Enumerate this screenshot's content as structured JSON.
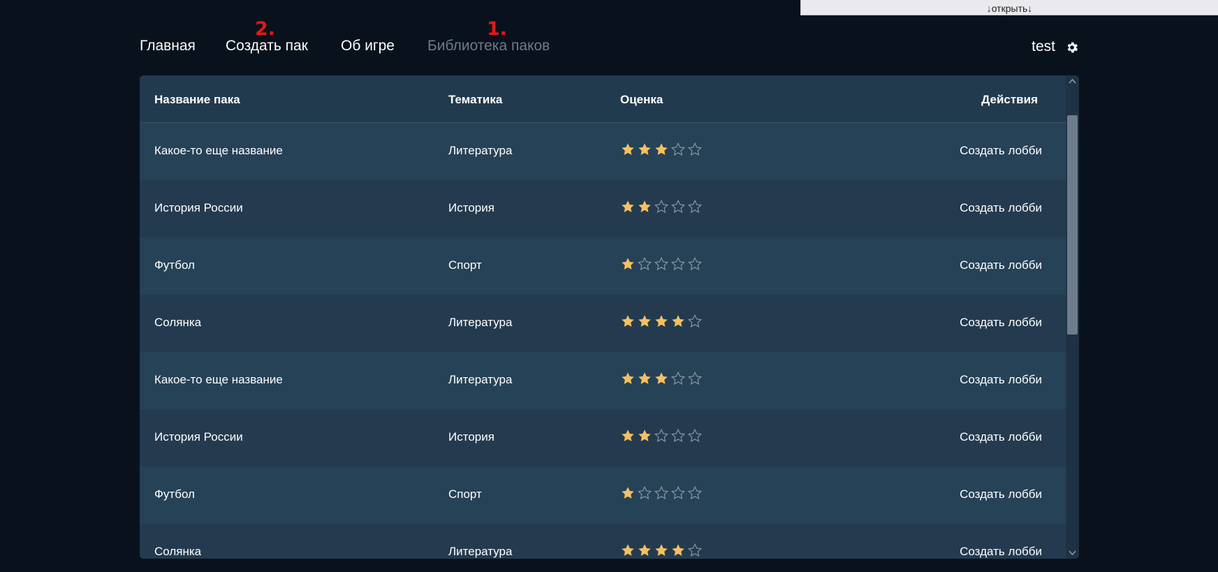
{
  "top_tab": {
    "label": "↓открыть↓"
  },
  "nav": {
    "items": [
      {
        "label": "Главная",
        "active": false
      },
      {
        "label": "Создать пак",
        "active": false,
        "marker": "2."
      },
      {
        "label": "Об игре",
        "active": false
      },
      {
        "label": "Библиотека паков",
        "active": true,
        "marker": "1."
      }
    ]
  },
  "user": {
    "name": "test",
    "settings_icon": "gear-icon"
  },
  "table": {
    "headers": {
      "name": "Название пака",
      "theme": "Тематика",
      "rating": "Оценка",
      "actions": "Действия"
    },
    "rows": [
      {
        "name": "Какое-то еще название",
        "theme": "Литература",
        "rating": 3,
        "action": "Создать лобби"
      },
      {
        "name": "История России",
        "theme": "История",
        "rating": 2,
        "action": "Создать лобби"
      },
      {
        "name": "Футбол",
        "theme": "Спорт",
        "rating": 1,
        "action": "Создать лобби"
      },
      {
        "name": "Солянка",
        "theme": "Литература",
        "rating": 4,
        "action": "Создать лобби"
      },
      {
        "name": "Какое-то еще название",
        "theme": "Литература",
        "rating": 3,
        "action": "Создать лобби"
      },
      {
        "name": "История России",
        "theme": "История",
        "rating": 2,
        "action": "Создать лобби"
      },
      {
        "name": "Футбол",
        "theme": "Спорт",
        "rating": 1,
        "action": "Создать лобби"
      },
      {
        "name": "Солянка",
        "theme": "Литература",
        "rating": 4,
        "action": "Создать лобби"
      }
    ],
    "rating_max": 5
  },
  "colors": {
    "background": "#09121c",
    "star_filled": "#f5c061",
    "star_empty_stroke": "#8a97a3",
    "marker": "#e21818",
    "nav_active": "#6c7b8b"
  }
}
